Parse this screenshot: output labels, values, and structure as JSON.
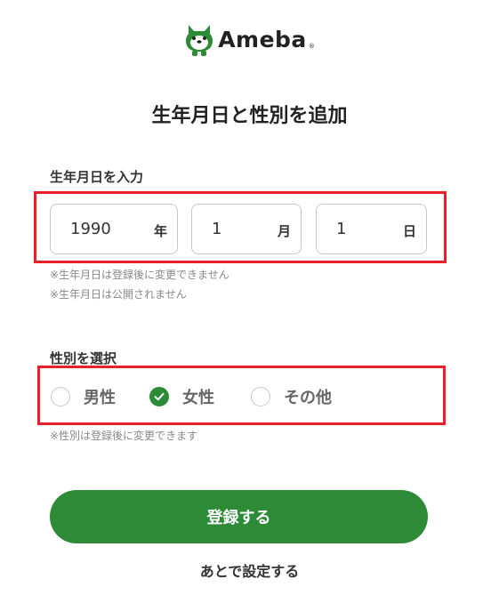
{
  "header": {
    "logo_text": "Ameba",
    "logo_mark": "®",
    "logo_icon": "ameba-mascot-icon"
  },
  "page": {
    "title": "生年月日と性別を追加"
  },
  "birthdate": {
    "label": "生年月日を入力",
    "year": {
      "value": "1990",
      "unit": "年"
    },
    "month": {
      "value": "1",
      "unit": "月"
    },
    "day": {
      "value": "1",
      "unit": "日"
    },
    "notes": [
      "※生年月日は登録後に変更できません",
      "※生年月日は公開されません"
    ]
  },
  "gender": {
    "label": "性別を選択",
    "options": [
      {
        "label": "男性",
        "checked": false
      },
      {
        "label": "女性",
        "checked": true
      },
      {
        "label": "その他",
        "checked": false
      }
    ],
    "note": "※性別は登録後に変更できます"
  },
  "actions": {
    "submit_label": "登録する",
    "later_label": "あとで設定する"
  },
  "colors": {
    "brand_green": "#2d8a36",
    "highlight_red": "#e8202a"
  }
}
